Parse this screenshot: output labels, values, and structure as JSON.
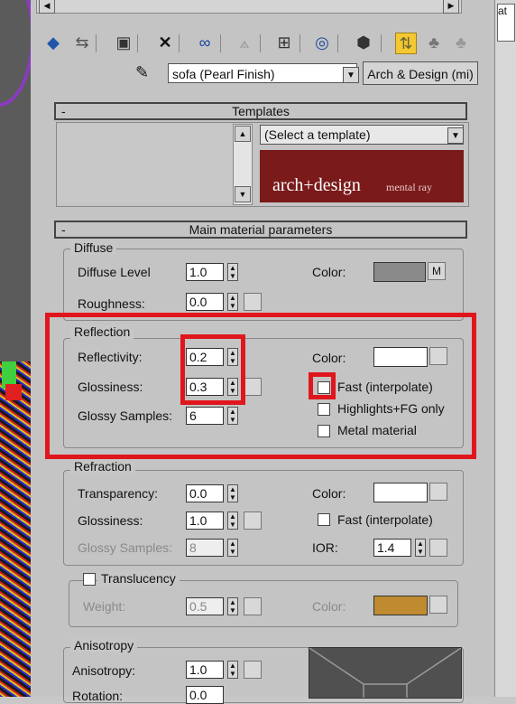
{
  "toolbar": {
    "icons": [
      "get-material-icon",
      "put-to-scene-icon",
      "assign-material-icon",
      "delete-icon",
      "make-unique-icon",
      "put-to-library-icon",
      "material-id-icon",
      "show-map-icon",
      "show-end-result-icon",
      "go-to-parent-icon",
      "go-forward-sibling-icon",
      "pick-from-object-icon"
    ]
  },
  "material": {
    "name": "sofa (Pearl Finish)",
    "type": "Arch & Design (mi)"
  },
  "right_strip": {
    "label": "at"
  },
  "templates": {
    "header": "Templates",
    "minus": "-",
    "select_value": "(Select a template)",
    "banner_brand": "arch+design",
    "banner_sub": "mental ray"
  },
  "main": {
    "header": "Main material parameters",
    "minus": "-",
    "diffuse": {
      "title": "Diffuse",
      "level_label": "Diffuse Level",
      "level": "1.0",
      "roughness_label": "Roughness:",
      "roughness": "0.0",
      "color_label": "Color:",
      "color": "#8a8a8a",
      "map_label": "M"
    },
    "reflection": {
      "title": "Reflection",
      "reflectivity_label": "Reflectivity:",
      "reflectivity": "0.2",
      "glossiness_label": "Glossiness:",
      "glossiness": "0.3",
      "samples_label": "Glossy Samples:",
      "samples": "6",
      "color_label": "Color:",
      "color": "#ffffff",
      "fast_label": "Fast (interpolate)",
      "highlights_label": "Highlights+FG only",
      "metal_label": "Metal material"
    },
    "refraction": {
      "title": "Refraction",
      "transparency_label": "Transparency:",
      "transparency": "0.0",
      "glossiness_label": "Glossiness:",
      "glossiness": "1.0",
      "samples_label": "Glossy Samples:",
      "samples": "8",
      "color_label": "Color:",
      "color": "#ffffff",
      "fast_label": "Fast (interpolate)",
      "ior_label": "IOR:",
      "ior": "1.4"
    },
    "translucency": {
      "title": "Translucency",
      "weight_label": "Weight:",
      "weight": "0.5",
      "color_label": "Color:",
      "color": "#c08a30"
    },
    "anisotropy": {
      "title": "Anisotropy",
      "anisotropy_label": "Anisotropy:",
      "anisotropy": "1.0",
      "rotation_label": "Rotation:",
      "rotation": "0.0"
    }
  },
  "colors": {
    "highlight_red": "#e0161c",
    "banner_bg": "#7a1a1a",
    "toolbar_active": "#f4c832"
  }
}
